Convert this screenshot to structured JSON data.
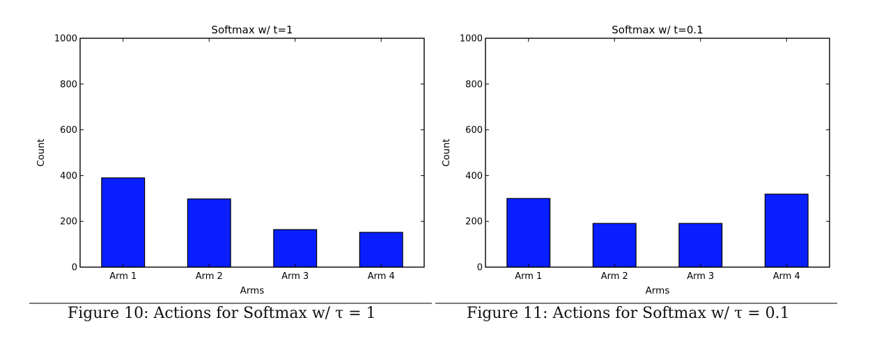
{
  "chart_data": [
    {
      "type": "bar",
      "title": "Softmax w/ t=1",
      "xlabel": "Arms",
      "ylabel": "Count",
      "categories": [
        "Arm 1",
        "Arm 2",
        "Arm 3",
        "Arm 4"
      ],
      "values": [
        390,
        298,
        164,
        152
      ],
      "ylim": [
        0,
        1000
      ],
      "yticks": [
        0,
        200,
        400,
        600,
        800,
        1000
      ],
      "ytick_labels": [
        "0",
        "200",
        "400",
        "600",
        "800",
        "1000"
      ],
      "grid": false,
      "bar_color": "#0a1fff",
      "caption": "Figure 10: Actions for Softmax w/ τ = 1"
    },
    {
      "type": "bar",
      "title": "Softmax w/ t=0.1",
      "xlabel": "Arms",
      "ylabel": "Count",
      "categories": [
        "Arm 1",
        "Arm 2",
        "Arm 3",
        "Arm 4"
      ],
      "values": [
        300,
        191,
        191,
        319
      ],
      "ylim": [
        0,
        1000
      ],
      "yticks": [
        0,
        200,
        400,
        600,
        800,
        1000
      ],
      "ytick_labels": [
        "0",
        "200",
        "400",
        "600",
        "800",
        "1000"
      ],
      "grid": false,
      "bar_color": "#0a1fff",
      "caption": "Figure 11: Actions for Softmax w/ τ = 0.1"
    }
  ]
}
